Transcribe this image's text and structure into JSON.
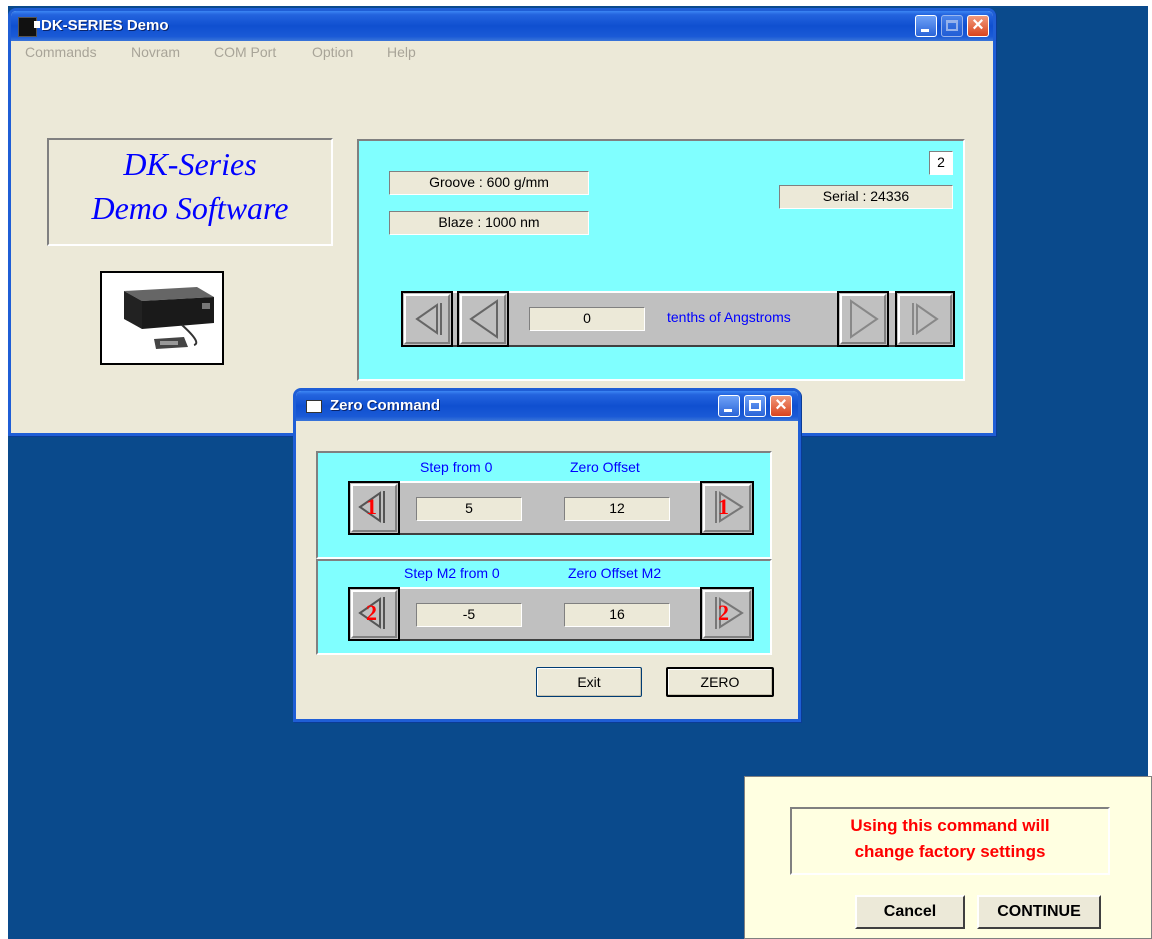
{
  "main_window": {
    "title": "DK-SERIES Demo",
    "menu": [
      "Commands",
      "Novram",
      "COM Port",
      "Option",
      "Help"
    ],
    "logo_line1": "DK-Series",
    "logo_line2": "Demo Software",
    "groove": "Groove : 600 g/mm",
    "blaze": "Blaze : 1000 nm",
    "unit_number": "2",
    "serial": "Serial : 24336",
    "position_value": "0",
    "position_units": "tenths of Angstroms",
    "product_image": "monochromator-photo"
  },
  "zero_dialog": {
    "title": "Zero Command",
    "m1": {
      "step_label": "Step from 0",
      "offset_label": "Zero Offset",
      "step_value": "5",
      "offset_value": "12",
      "left_mark": "1",
      "right_mark": "1"
    },
    "m2": {
      "step_label": "Step M2 from 0",
      "offset_label": "Zero Offset M2",
      "step_value": "-5",
      "offset_value": "16",
      "left_mark": "2",
      "right_mark": "2"
    },
    "exit_label": "Exit",
    "zero_label": "ZERO"
  },
  "warning_dialog": {
    "message_line1": "Using this command will",
    "message_line2": "change factory settings",
    "cancel_label": "Cancel",
    "continue_label": "CONTINUE"
  },
  "colors": {
    "desktop": "#0a4a8c",
    "panel": "#80ffff",
    "warning_text": "#ff0000",
    "label_text": "#0000ff"
  }
}
